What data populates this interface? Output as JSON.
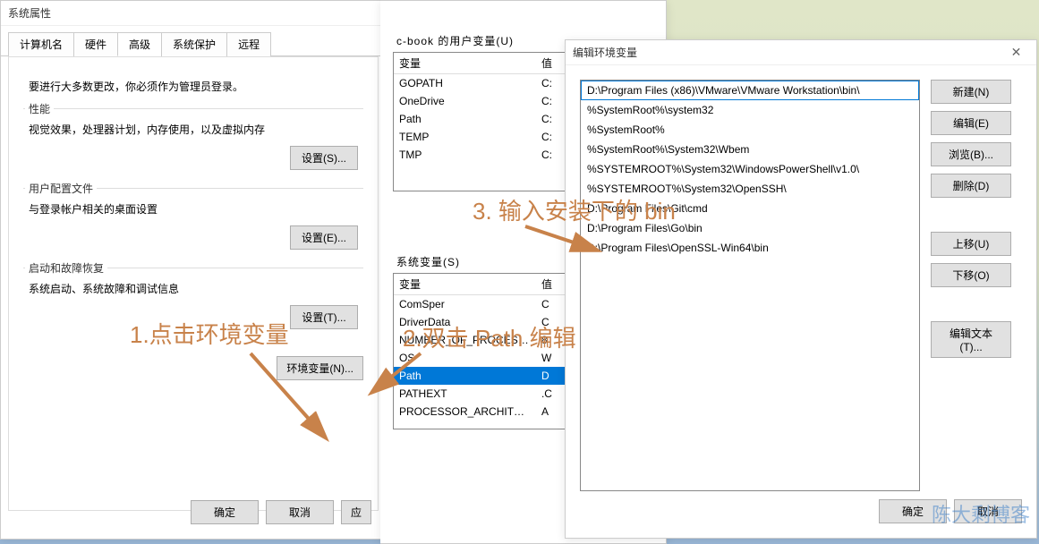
{
  "sysprops": {
    "title": "系统属性",
    "tabs": [
      "计算机名",
      "硬件",
      "高级",
      "系统保护",
      "远程"
    ],
    "active_tab_index": 2,
    "note": "要进行大多数更改，你必须作为管理员登录。",
    "perf": {
      "title": "性能",
      "text": "视觉效果，处理器计划，内存使用，以及虚拟内存",
      "btn": "设置(S)..."
    },
    "profile": {
      "title": "用户配置文件",
      "text": "与登录帐户相关的桌面设置",
      "btn": "设置(E)..."
    },
    "startup": {
      "title": "启动和故障恢复",
      "text": "系统启动、系统故障和调试信息",
      "btn": "设置(T)..."
    },
    "env_btn": "环境变量(N)...",
    "ok": "确定",
    "cancel": "取消",
    "apply": "应"
  },
  "envvars": {
    "user_label": "c-book 的用户变量(U)",
    "sys_label": "系统变量(S)",
    "col_var": "变量",
    "col_val": "值",
    "user_rows": [
      {
        "n": "GOPATH",
        "v": "C:"
      },
      {
        "n": "OneDrive",
        "v": "C:"
      },
      {
        "n": "Path",
        "v": "C:"
      },
      {
        "n": "TEMP",
        "v": "C:"
      },
      {
        "n": "TMP",
        "v": "C:"
      }
    ],
    "sys_rows": [
      {
        "n": "变量",
        "v": "值"
      },
      {
        "n": "ComSper",
        "v": "C"
      },
      {
        "n": "DriverData",
        "v": "C"
      },
      {
        "n": "NUMBER_OF_PROCESSORS",
        "v": "8"
      },
      {
        "n": "OS",
        "v": "W"
      },
      {
        "n": "Path",
        "v": "D"
      },
      {
        "n": "PATHEXT",
        "v": ".C"
      },
      {
        "n": "PROCESSOR_ARCHITECT...",
        "v": "A"
      }
    ]
  },
  "editpath": {
    "title": "编辑环境变量",
    "rows": [
      "D:\\Program Files (x86)\\VMware\\VMware Workstation\\bin\\",
      "%SystemRoot%\\system32",
      "%SystemRoot%",
      "%SystemRoot%\\System32\\Wbem",
      "%SYSTEMROOT%\\System32\\WindowsPowerShell\\v1.0\\",
      "%SYSTEMROOT%\\System32\\OpenSSH\\",
      "D:\\Program Files\\Git\\cmd",
      "D:\\Program Files\\Go\\bin",
      "D:\\Program Files\\OpenSSL-Win64\\bin"
    ],
    "selected_index": 0,
    "btns": {
      "new": "新建(N)",
      "edit": "编辑(E)",
      "browse": "浏览(B)...",
      "delete": "删除(D)",
      "up": "上移(U)",
      "down": "下移(O)",
      "edittext": "编辑文本(T)..."
    },
    "ok": "确定",
    "cancel": "取消"
  },
  "annotations": {
    "a1": "1.点击环境变量",
    "a2": "2.双击 Path 编辑",
    "a3": "3. 输入安装下的 bin"
  },
  "watermark": "陈大剩博客"
}
